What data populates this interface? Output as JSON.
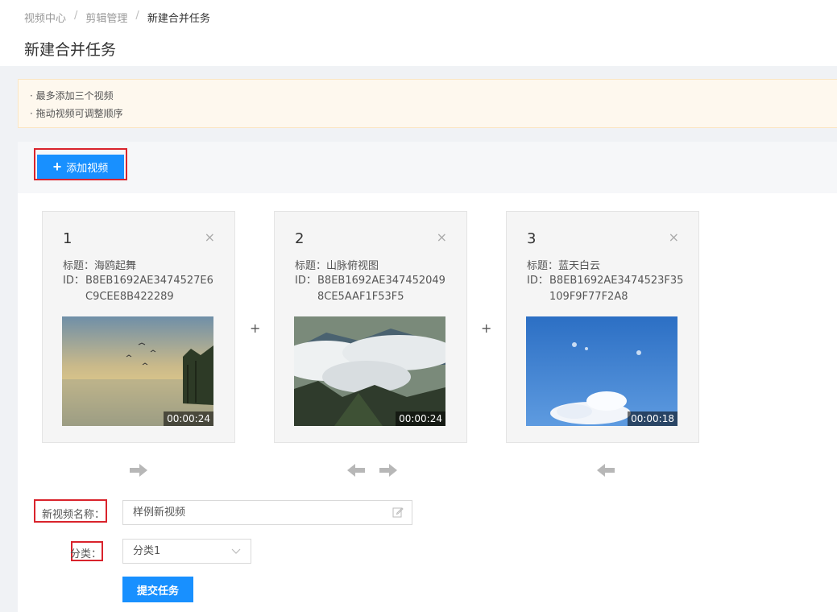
{
  "breadcrumb": {
    "items": [
      "视频中心",
      "剪辑管理"
    ],
    "current": "新建合并任务",
    "separator": "/"
  },
  "page_title": "新建合并任务",
  "notice": {
    "lines": [
      "· 最多添加三个视频",
      "· 拖动视频可调整顺序"
    ]
  },
  "toolbar": {
    "add_label": "添加视频",
    "add_icon": "plus-icon"
  },
  "videos": [
    {
      "index": "1",
      "title": "标题：海鸥起舞",
      "id_label": "ID：",
      "id": "B8EB1692AE3474527E6C9CEE8B422289",
      "duration": "00:00:24"
    },
    {
      "index": "2",
      "title": "标题：山脉俯视图",
      "id_label": "ID：",
      "id": "B8EB1692AE3474520498CE5AAF1F53F5",
      "duration": "00:00:24"
    },
    {
      "index": "3",
      "title": "标题：蓝天白云",
      "id_label": "ID：",
      "id": "B8EB1692AE3474523F35109F9F77F2A8",
      "duration": "00:00:18"
    }
  ],
  "join_symbol": "+",
  "form": {
    "name_label": "新视频名称：",
    "name_value": "样例新视频",
    "category_label": "分类：",
    "category_value": "分类1",
    "submit_label": "提交任务"
  },
  "colors": {
    "primary": "#1890ff",
    "highlight": "#d9232c",
    "notice_bg": "#fef8ee"
  }
}
